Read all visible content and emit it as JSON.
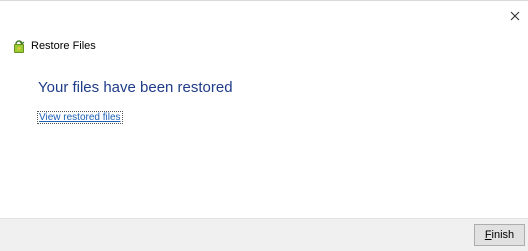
{
  "window": {
    "close_icon": "close-icon"
  },
  "header": {
    "icon": "restore-files-icon",
    "title": "Restore Files"
  },
  "main": {
    "heading": "Your files have been restored",
    "link_label": "View restored files"
  },
  "footer": {
    "finish_accel": "F",
    "finish_rest": "inish"
  },
  "colors": {
    "heading": "#1f3c88",
    "link": "#1a5fb4",
    "footer_bg": "#f0f0f0"
  }
}
